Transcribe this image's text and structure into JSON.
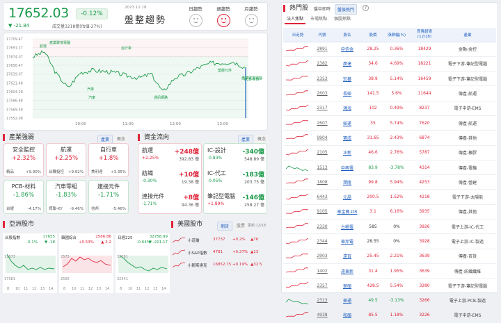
{
  "header": {
    "value": "17652.03",
    "pct": "-0.12%",
    "chg": "▼ -21.84",
    "volume": "成交量3218億(估値-27%)",
    "date": "2023.12.18",
    "trend": "盤整趨勢",
    "periods": [
      {
        "label": "日趨勢",
        "active": false
      },
      {
        "label": "週趨勢",
        "active": true
      },
      {
        "label": "月趨勢",
        "active": false
      }
    ]
  },
  "chart_data": {
    "type": "line",
    "title": "",
    "x_ticks": [
      "10:00",
      "11:00",
      "12:00",
      "13:00"
    ],
    "y_ticks": [
      "17709.47",
      "17691.27",
      "17674.07",
      "17656.47",
      "17639.07",
      "17621.48",
      "17604.28",
      "17586.88",
      "17569.48",
      "17552.08"
    ],
    "ylim": [
      17552.08,
      17709.47
    ],
    "reference": 17673.87,
    "x": [
      "09:00",
      "09:15",
      "09:30",
      "09:45",
      "10:00",
      "10:15",
      "10:30",
      "10:45",
      "11:00",
      "11:15",
      "11:30",
      "11:45",
      "12:00",
      "12:15",
      "12:30",
      "12:45",
      "13:00",
      "13:15",
      "13:25"
    ],
    "values": [
      17674,
      17684,
      17640,
      17612,
      17642,
      17647,
      17645,
      17642,
      17636,
      17632,
      17640,
      17604,
      17632,
      17640,
      17652,
      17661,
      17662,
      17664,
      17652
    ],
    "annotations": [
      "航運",
      "產業聚落電腦",
      "自行車",
      "汽車",
      "汽車",
      "通訊網路",
      "塑膠元件",
      "產業聚落電腦",
      "PCB-材料"
    ]
  },
  "industry": {
    "title": "產業強弱",
    "tabs": [
      "產業",
      "概念"
    ],
    "cards": [
      {
        "name": "安全監控",
        "pct": "+2.32%",
        "dir": "up",
        "stocks": [
          {
            "n": "精品",
            "p": "+9.90%"
          }
        ]
      },
      {
        "name": "航運",
        "pct": "+2.25%",
        "dir": "up",
        "stocks": [
          {
            "n": "台驊投控",
            "p": "+9.92%"
          }
        ]
      },
      {
        "name": "自行車",
        "pct": "+1.8%",
        "dir": "up",
        "stocks": [
          {
            "n": "美利達",
            "p": "+3.35%"
          }
        ]
      },
      {
        "name": "PCB-材料",
        "pct": "-1.86%",
        "dir": "dn",
        "stocks": [
          {
            "n": "台燿",
            "p": "-4.17%"
          }
        ]
      },
      {
        "name": "汽車零組",
        "pct": "-1.83%",
        "dir": "dn",
        "stocks": [
          {
            "n": "貿聯-KY",
            "p": "-9.46%"
          }
        ]
      },
      {
        "name": "連接元件",
        "pct": "-1.71%",
        "dir": "dn",
        "stocks": [
          {
            "n": "信邦",
            "p": "-5.46%"
          }
        ]
      }
    ]
  },
  "money": {
    "title": "資金流向",
    "tabs": [
      "產業",
      "概念"
    ],
    "items": [
      {
        "name": "航運",
        "val": "+248億",
        "rate": "+2.25%",
        "amt": "392.83 億",
        "dir": "up"
      },
      {
        "name": "紡織",
        "val": "+10億",
        "rate": "-0.30%",
        "amt": "19.38 億",
        "dir": "up"
      },
      {
        "name": "連接元件",
        "val": "+8億",
        "rate": "-1.71%",
        "amt": "94.36 億",
        "dir": "up"
      },
      {
        "name": "IC-設計",
        "val": "-340億",
        "rate": "-0.83%",
        "amt": "548.89 億",
        "dir": "dn"
      },
      {
        "name": "IC-代工",
        "val": "-183億",
        "rate": "-0.05%",
        "amt": "203.75 億",
        "dir": "dn"
      },
      {
        "name": "筆記型電腦",
        "val": "-146億",
        "rate": "+1.89%",
        "amt": "258.27 億",
        "dir": "dn"
      }
    ]
  },
  "asia": {
    "title": "亞洲股市",
    "cards": [
      {
        "name": "台股指數",
        "val": "17655",
        "chg": "-0.1%",
        "pt": "▼ -18",
        "dir": "dn",
        "ylabels": [
          "17673",
          "17581"
        ],
        "x": [
          "8",
          "10",
          "11",
          "12",
          "13",
          "14"
        ]
      },
      {
        "name": "韓國綜合",
        "val": "2566.86",
        "chg": "+0.53%",
        "pt": "▲ 3.2",
        "dir": "up",
        "ylabels": [
          "2573",
          "2556"
        ],
        "x": [
          "8",
          "10",
          "11",
          "12",
          "13",
          "14"
        ]
      },
      {
        "name": "日經225",
        "val": "32758.99",
        "chg": "-0.64%",
        "pt": "▼ -211.17",
        "dir": "dn",
        "ylabels": [
          "32791",
          "32541"
        ],
        "x": [
          "8",
          "10",
          "11",
          "12",
          "13",
          "14"
        ]
      }
    ]
  },
  "us": {
    "title": "美國股市",
    "tabs": [
      "期貨",
      "股票"
    ],
    "date": "更新:12/18",
    "rows": [
      {
        "name": "小道瓊",
        "val": "37737",
        "pct": "+0.2%",
        "pt": "▲76"
      },
      {
        "name": "小S&P指數",
        "val": "4781",
        "pct": "+0.27%",
        "pt": "▲13"
      },
      {
        "name": "小那斯達克",
        "val": "16852.75",
        "pct": "+0.19%",
        "pt": "▲32.5"
      }
    ]
  },
  "hot": {
    "title": "熱門股",
    "tabs": [
      "盤中即時",
      "盤後熱門"
    ],
    "subtabs": [
      "法人焦點",
      "市場焦點",
      "個股熱點"
    ],
    "columns": [
      "日走勢",
      "代號",
      "股名",
      "股價",
      "漲跌幅(%)",
      "買賣超張\n(12/18)",
      "產業"
    ],
    "rows": [
      {
        "code": "2891",
        "name": "中信金",
        "price": "28.25",
        "pct": "0.36%",
        "vol": "18429",
        "ind": "金融-金控",
        "dir": "up"
      },
      {
        "code": "2382",
        "name": "廣達",
        "price": "34.6",
        "pct": "4.69%",
        "vol": "18221",
        "ind": "電子下游-筆記型電腦",
        "dir": "up"
      },
      {
        "code": "2353",
        "name": "宏碁",
        "price": "38.9",
        "pct": "5.14%",
        "vol": "16459",
        "ind": "電子下游-筆記型電腦",
        "dir": "up"
      },
      {
        "code": "2603",
        "name": "長榮",
        "price": "141.5",
        "pct": "5.6%",
        "vol": "11644",
        "ind": "傳產-航運",
        "dir": "up"
      },
      {
        "code": "2317",
        "name": "鴻海",
        "price": "102",
        "pct": "0.49%",
        "vol": "8237",
        "ind": "電子中游-EMS",
        "dir": "up"
      },
      {
        "code": "2607",
        "name": "榮運",
        "price": "35",
        "pct": "5.74%",
        "vol": "7620",
        "ind": "傳產-航運",
        "dir": "up"
      },
      {
        "code": "9904",
        "name": "寶成",
        "price": "31.65",
        "pct": "2.43%",
        "vol": "6874",
        "ind": "傳產-其他",
        "dir": "up"
      },
      {
        "code": "2105",
        "name": "正新",
        "price": "46.6",
        "pct": "2.76%",
        "vol": "5787",
        "ind": "傳產-橡膠",
        "dir": "up"
      },
      {
        "code": "1513",
        "name": "中興電",
        "price": "83.9",
        "pct": "-3.78%",
        "vol": "4314",
        "ind": "傳產-電機",
        "dir": "dn"
      },
      {
        "code": "1808",
        "name": "潤隆",
        "price": "99.8",
        "pct": "5.94%",
        "vol": "4253",
        "ind": "傳產-營建",
        "dir": "up"
      },
      {
        "code": "6443",
        "name": "元晶",
        "price": "200.5",
        "pct": "1.52%",
        "vol": "4218",
        "ind": "電子下游-太陽能",
        "dir": "up"
      },
      {
        "code": "9105",
        "name": "泰金寶-DR",
        "price": "3.1",
        "pct": "6.16%",
        "vol": "3935",
        "ind": "傳產-其他",
        "dir": "up"
      },
      {
        "code": "2330",
        "name": "台積電",
        "price": "585",
        "pct": "0%",
        "vol": "3926",
        "ind": "電子上游-IC-代工",
        "dir": "flat"
      },
      {
        "code": "2344",
        "name": "華邦電",
        "price": "28.55",
        "pct": "0%",
        "vol": "3928",
        "ind": "電子上游-IC-製造",
        "dir": "flat"
      },
      {
        "code": "2903",
        "name": "遠百",
        "price": "25.45",
        "pct": "2.21%",
        "vol": "3639",
        "ind": "傳產-百貨",
        "dir": "up"
      },
      {
        "code": "1402",
        "name": "遠東新",
        "price": "31.4",
        "pct": "1.95%",
        "vol": "3639",
        "ind": "傳產-紡織纖維",
        "dir": "up"
      },
      {
        "code": "2357",
        "name": "華碩",
        "price": "428.5",
        "pct": "5.54%",
        "vol": "3280",
        "ind": "電子下游-筆記型電腦",
        "dir": "up"
      },
      {
        "code": "2313",
        "name": "華通",
        "price": "49.5",
        "pct": "-3.13%",
        "vol": "3266",
        "ind": "電子上游-PCB-製造",
        "dir": "dn"
      },
      {
        "code": "4938",
        "name": "和碩",
        "price": "85.5",
        "pct": "1.18%",
        "vol": "3226",
        "ind": "電子中游-EMS",
        "dir": "up"
      }
    ]
  }
}
